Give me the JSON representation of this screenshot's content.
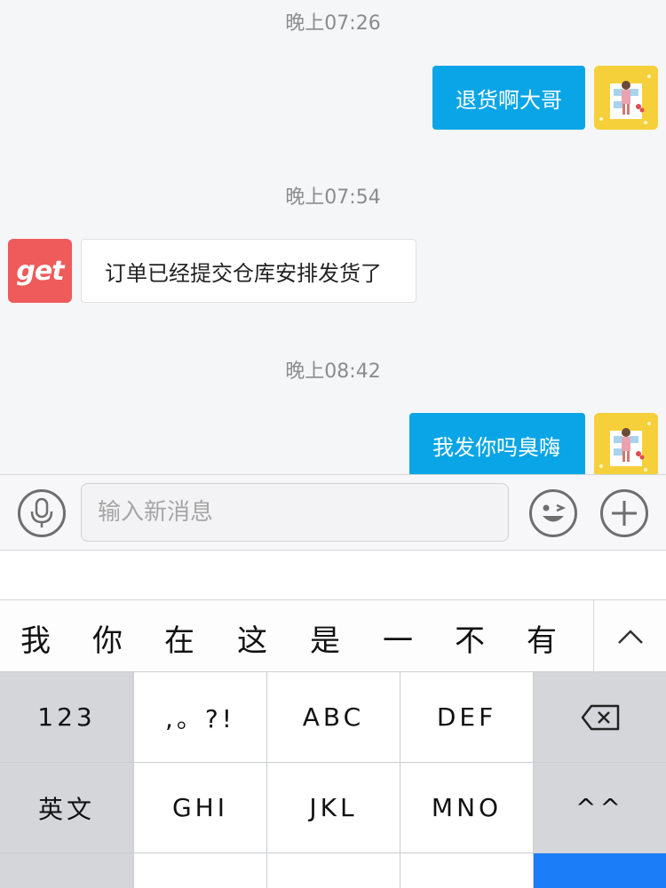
{
  "chat": {
    "messages": [
      {
        "time": "晚上07:26",
        "text": "退货啊大哥",
        "direction": "outgoing"
      },
      {
        "time": "晚上07:54",
        "text": "订单已经提交仓库安排发货了",
        "direction": "incoming",
        "sender_avatar_text": "get"
      },
      {
        "time": "晚上08:42",
        "text": "我发你吗臭嗨",
        "direction": "outgoing"
      }
    ]
  },
  "input_bar": {
    "voice_icon": "microphone-icon",
    "placeholder": "输入新消息",
    "emoji_icon": "wink-emoji-icon",
    "plus_icon": "plus-icon"
  },
  "candidates": {
    "items": [
      "我",
      "你",
      "在",
      "这",
      "是",
      "一",
      "不",
      "有"
    ],
    "expand_icon": "chevron-up-icon"
  },
  "keyboard": {
    "row1": [
      "123",
      ",。?!",
      "ABC",
      "DEF"
    ],
    "row2": [
      "英文",
      "GHI",
      "JKL",
      "MNO",
      "^^"
    ],
    "delete_icon": "backspace-icon"
  },
  "colors": {
    "outgoing_bubble": "#0aa5e6",
    "incoming_bubble": "#ffffff",
    "shop_avatar": "#ef5a5a",
    "keyboard_accent": "#1b7ef8"
  }
}
